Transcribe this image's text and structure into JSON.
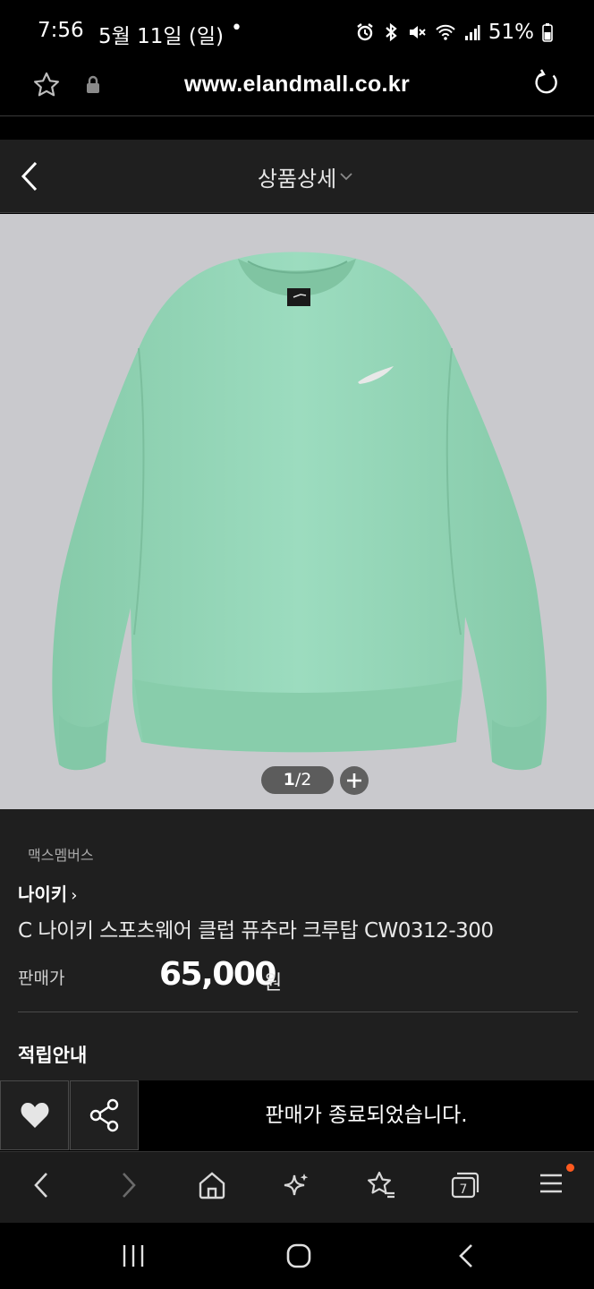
{
  "status_bar": {
    "time": "7:56",
    "date": "5월 11일 (일)",
    "dot": "•",
    "battery": "51%"
  },
  "browser": {
    "url": "www.elandmall.co.kr"
  },
  "header": {
    "title": "상품상세"
  },
  "gallery": {
    "current": "1",
    "separator": "/",
    "total": "2"
  },
  "product": {
    "seller": "맥스멤버스",
    "brand": "나이키",
    "brand_arrow": "›",
    "name": "C 나이키 스포츠웨어 클럽 퓨추라 크루탑 CW0312-300",
    "price_label": "판매가",
    "price": "65,000",
    "price_unit": "원",
    "points_heading": "적립안내",
    "sweatshirt_color": "#98d8bb"
  },
  "actions": {
    "soldout_label": "판매가 종료되었습니다."
  },
  "browser_nav": {
    "tab_count": "7",
    "notification_color": "#ff5a1f"
  }
}
